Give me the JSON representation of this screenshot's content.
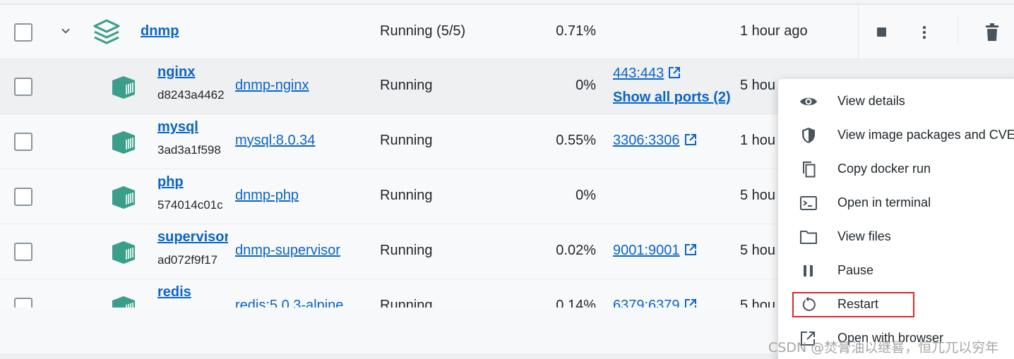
{
  "group": {
    "name": "dnmp",
    "status": "Running (5/5)",
    "cpu": "0.71%",
    "started": "1 hour ago"
  },
  "containers": [
    {
      "name": "nginx",
      "id": "d8243a4462",
      "image": "dnmp-nginx",
      "status": "Running",
      "cpu": "0%",
      "port": "443:443",
      "show_ports": "Show all ports (2)",
      "started": "5 hou"
    },
    {
      "name": "mysql",
      "id": "3ad3a1f598",
      "image": "mysql:8.0.34",
      "status": "Running",
      "cpu": "0.55%",
      "port": "3306:3306",
      "started": "1 hou"
    },
    {
      "name": "php",
      "id": "574014c01c",
      "image": "dnmp-php",
      "status": "Running",
      "cpu": "0%",
      "port": "",
      "started": "5 hou"
    },
    {
      "name": "supervisor",
      "id": "ad072f9f17",
      "image": "dnmp-supervisor",
      "status": "Running",
      "cpu": "0.02%",
      "port": "9001:9001",
      "started": "5 hou"
    },
    {
      "name": "redis",
      "id": "",
      "image": "redis:5.0.3-alpine",
      "status": "Running",
      "cpu": "0.14%",
      "port": "6379:6379",
      "started": "5 hou"
    }
  ],
  "menu": {
    "items": [
      {
        "label": "View details",
        "icon": "eye-icon"
      },
      {
        "label": "View image packages and CVEs",
        "icon": "shield-icon"
      },
      {
        "label": "Copy docker run",
        "icon": "copy-icon"
      },
      {
        "label": "Open in terminal",
        "icon": "terminal-icon"
      },
      {
        "label": "View files",
        "icon": "folder-icon"
      },
      {
        "label": "Pause",
        "icon": "pause-icon"
      },
      {
        "label": "Restart",
        "icon": "restart-icon"
      },
      {
        "label": "Open with browser",
        "icon": "open-external-icon"
      }
    ]
  },
  "watermark": "CSDN @焚膏油以继晷，恒兀兀以穷年",
  "colors": {
    "link": "#0b64c8",
    "icon_teal": "#3a9e8a",
    "highlight": "#e0262a"
  }
}
